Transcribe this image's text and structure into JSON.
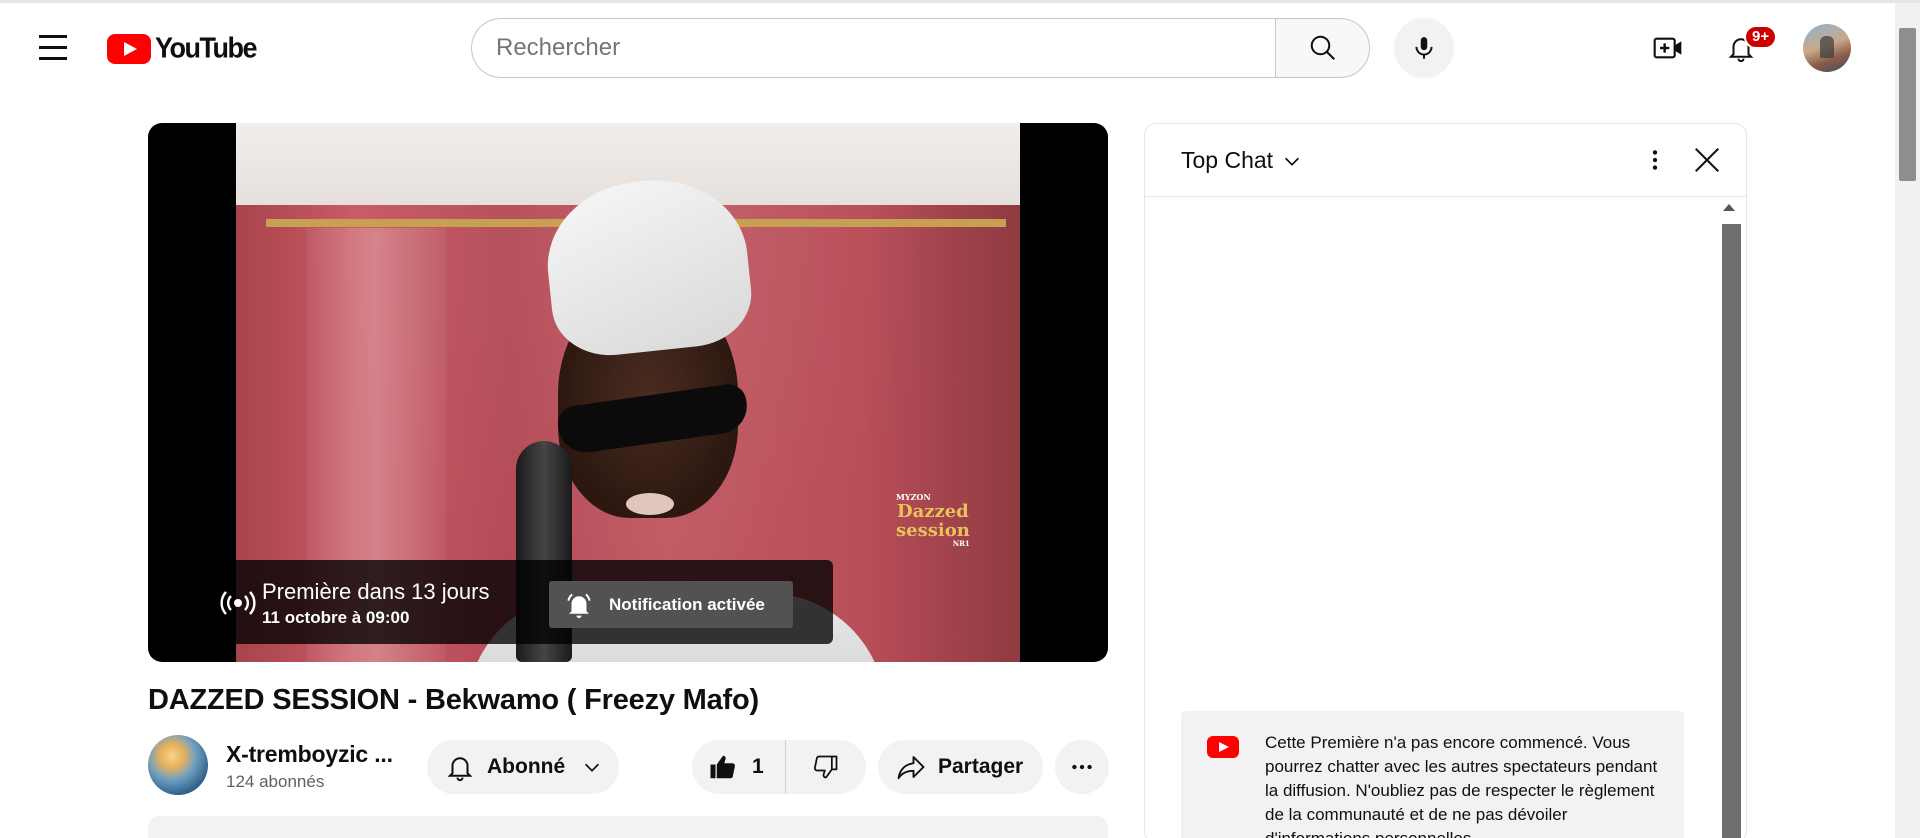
{
  "header": {
    "logo_text": "YouTube",
    "search_placeholder": "Rechercher",
    "notification_badge": "9+"
  },
  "player": {
    "premiere_title": "Première dans 13 jours",
    "premiere_date": "11 octobre à 09:00",
    "notification_label": "Notification activée"
  },
  "video": {
    "title": "DAZZED SESSION - Bekwamo ( Freezy Mafo)",
    "channel_name": "X-tremboyzic ...",
    "subscribers": "124 abonnés",
    "subscribe_label": "Abonné",
    "like_count": "1",
    "share_label": "Partager"
  },
  "chat": {
    "mode_label": "Top Chat",
    "notice": "Cette Première n'a pas encore commencé. Vous pourrez chatter avec les autres spectateurs pendant la diffusion. N'oubliez pas de respecter le règlement de la communauté et de ne pas dévoiler d'informations personnelles."
  },
  "colors": {
    "brand_red": "#ff0000",
    "badge_red": "#cc0000",
    "pill_bg": "#f2f2f2"
  },
  "icons": [
    "menu-icon",
    "search-icon",
    "microphone-icon",
    "create-video-icon",
    "bell-icon",
    "live-broadcast-icon",
    "bell-ringing-icon",
    "thumb-up-icon",
    "thumb-down-icon",
    "share-arrow-icon",
    "more-horizontal-icon",
    "chevron-down-icon",
    "more-vertical-icon",
    "close-icon",
    "youtube-logo-icon"
  ]
}
